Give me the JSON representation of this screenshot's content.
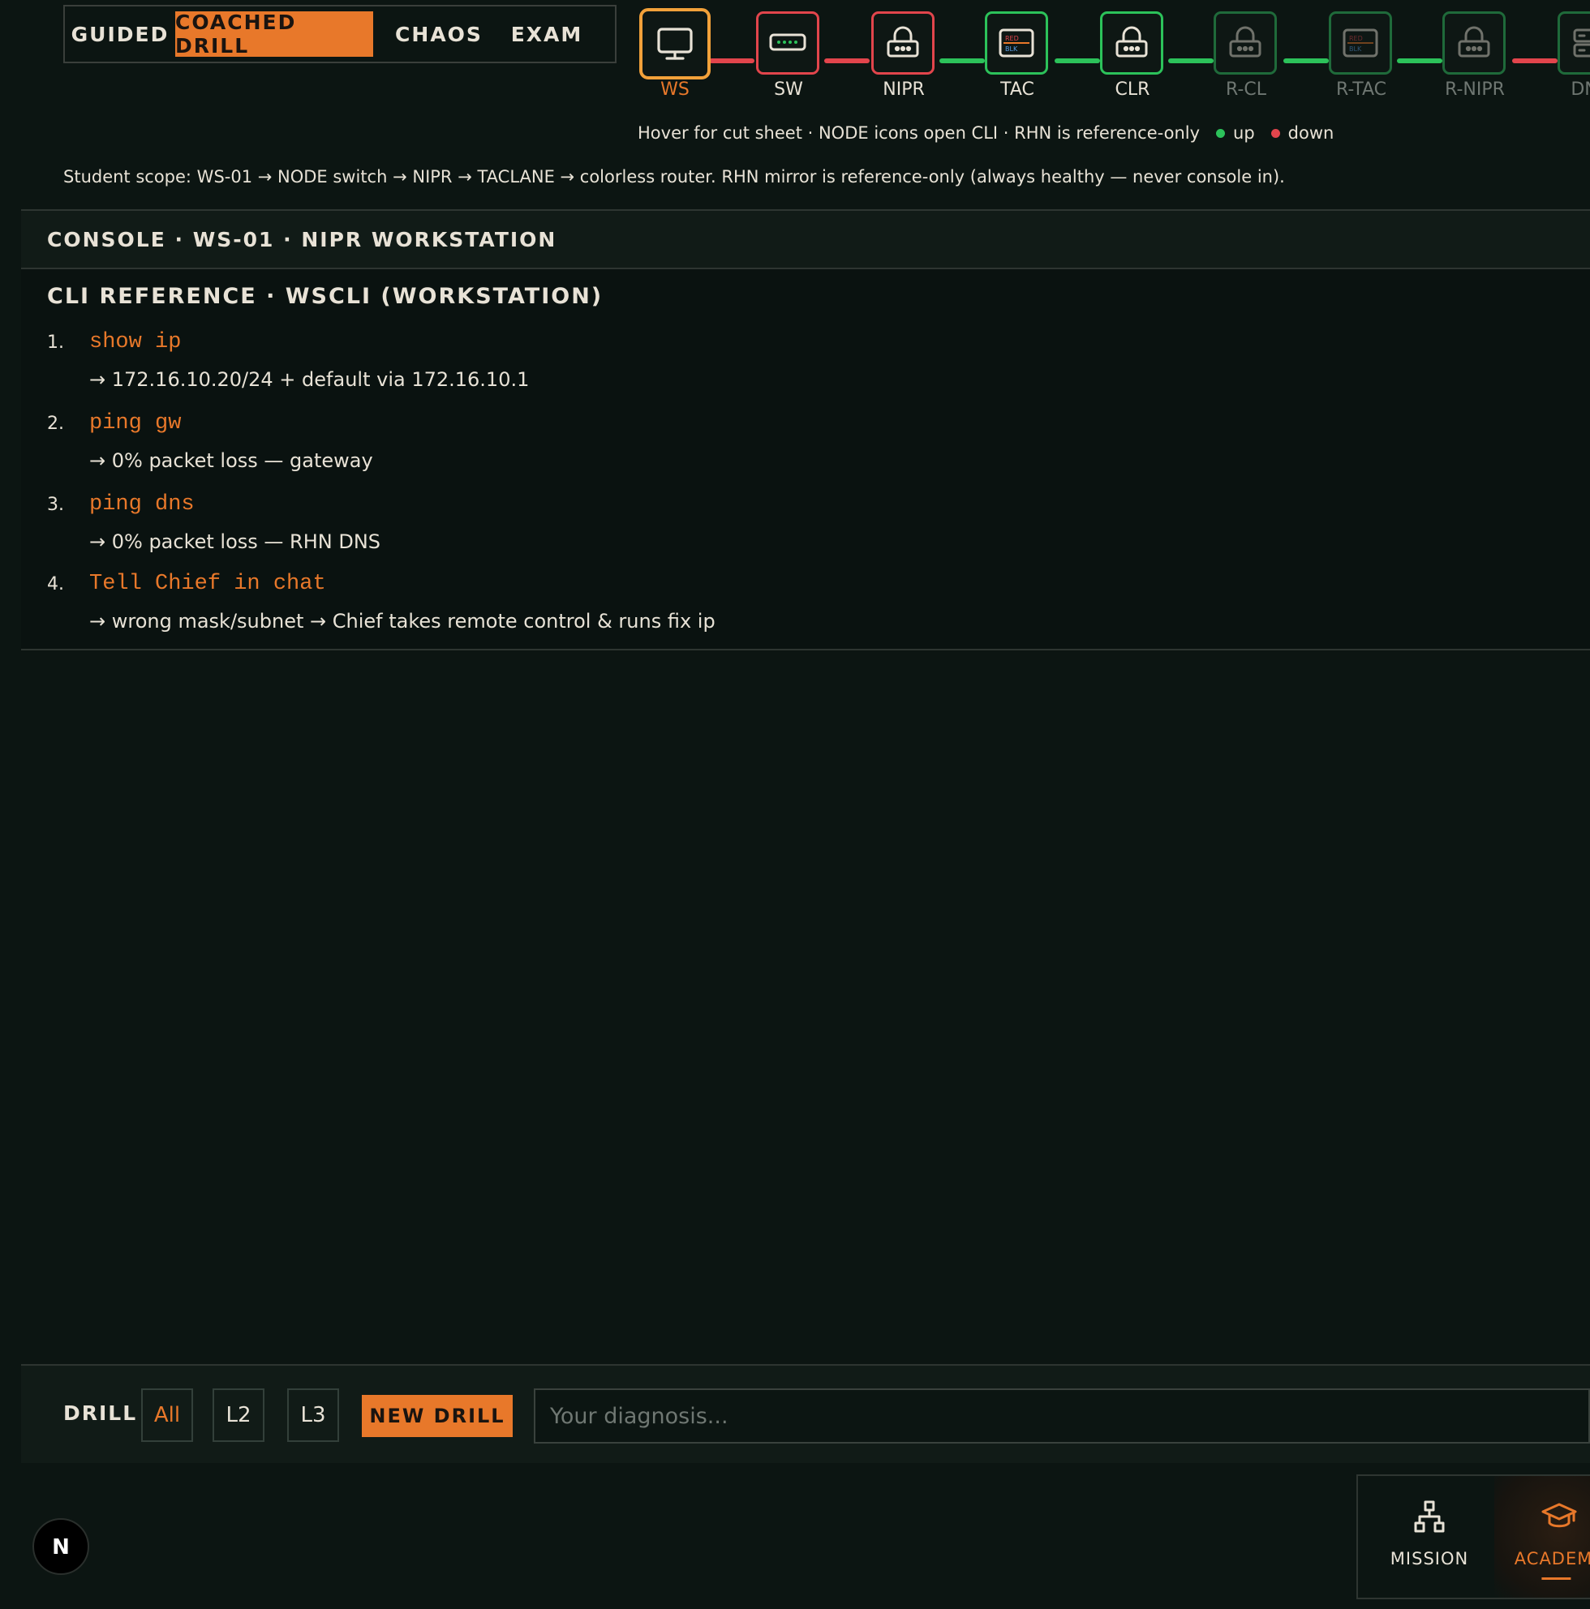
{
  "modes": {
    "tabs": [
      {
        "label": "GUIDED",
        "active": false
      },
      {
        "label": "COACHED DRILL",
        "active": true
      },
      {
        "label": "CHAOS",
        "active": false
      },
      {
        "label": "EXAM",
        "active": false
      }
    ]
  },
  "topology": {
    "nodes": [
      {
        "label": "WS",
        "icon": "monitor-icon",
        "status": "selected"
      },
      {
        "label": "SW",
        "icon": "switch-icon",
        "status": "down"
      },
      {
        "label": "NIPR",
        "icon": "router-icon",
        "status": "down"
      },
      {
        "label": "TAC",
        "icon": "taclane-icon",
        "status": "up"
      },
      {
        "label": "CLR",
        "icon": "router-icon",
        "status": "up"
      },
      {
        "label": "R-CL",
        "icon": "router-icon",
        "status": "reference"
      },
      {
        "label": "R-TAC",
        "icon": "taclane-icon",
        "status": "reference"
      },
      {
        "label": "R-NIPR",
        "icon": "router-icon",
        "status": "reference"
      },
      {
        "label": "DNS",
        "icon": "server-icon",
        "status": "reference"
      }
    ],
    "links": [
      "down",
      "down",
      "up",
      "up",
      "up",
      "up",
      "up",
      "down"
    ],
    "taclane_badge": {
      "top": "RED",
      "bottom": "BLK"
    },
    "legend": {
      "hint": "Hover for cut sheet · NODE icons open CLI · RHN is reference-only",
      "up": "up",
      "down": "down"
    }
  },
  "scope_text": "Student scope: WS-01 → NODE switch → NIPR → TACLANE → colorless router. RHN mirror is reference-only (always healthy — never console in).",
  "console": {
    "title": "CONSOLE · WS-01 · NIPR WORKSTATION",
    "cli_title": "CLI REFERENCE · WSCLI (WORKSTATION)",
    "steps": [
      {
        "num": "1.",
        "command": "show ip",
        "result": "→ 172.16.10.20/24 + default via 172.16.10.1"
      },
      {
        "num": "2.",
        "command": "ping gw",
        "result": "→ 0% packet loss — gateway"
      },
      {
        "num": "3.",
        "command": "ping dns",
        "result": "→ 0% packet loss — RHN DNS"
      },
      {
        "num": "4.",
        "command": "Tell Chief in chat",
        "result": "→ wrong mask/subnet → Chief takes remote control & runs fix ip"
      }
    ]
  },
  "drill": {
    "label": "DRILL",
    "levels": [
      {
        "label": "All",
        "active": true
      },
      {
        "label": "L2",
        "active": false
      },
      {
        "label": "L3",
        "active": false
      }
    ],
    "new_drill": "NEW DRILL",
    "input_placeholder": "Your diagnosis..."
  },
  "nav": {
    "badge": "N",
    "items": [
      {
        "label": "MISSION",
        "icon": "network-icon",
        "active": false
      },
      {
        "label": "ACADEMY",
        "icon": "graduation-cap-icon",
        "active": true
      }
    ]
  },
  "colors": {
    "accent": "#e8782a",
    "selected": "#f2a13a",
    "up": "#2cc25a",
    "down": "#e2454c",
    "background": "#0c1512"
  }
}
